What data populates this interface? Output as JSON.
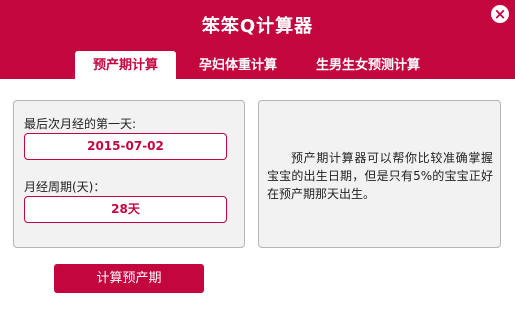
{
  "window": {
    "title": "笨笨Q计算器",
    "close_glyph": "×"
  },
  "tabs": [
    {
      "label": "预产期计算",
      "active": true
    },
    {
      "label": "孕妇体重计算",
      "active": false
    },
    {
      "label": "生男生女预测计算",
      "active": false
    }
  ],
  "form": {
    "last_period_label": "最后次月经的第一天:",
    "last_period_value": "2015-07-02",
    "cycle_label": "月经周期(天)：",
    "cycle_value": "28天"
  },
  "info": {
    "text": "预产期计算器可以帮你比较准确掌握宝宝的出生日期，但是只有5%的宝宝正好在预产期那天出生。"
  },
  "actions": {
    "calculate_label": "计算预产期"
  },
  "colors": {
    "brand": "#c4063f",
    "panel_bg": "#f2f2f2"
  }
}
